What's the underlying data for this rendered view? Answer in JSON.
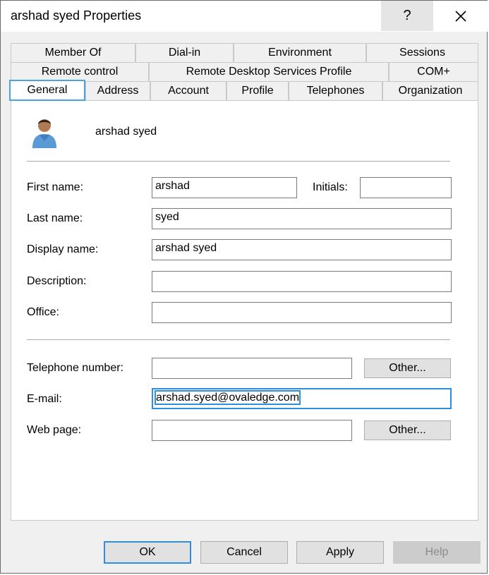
{
  "window": {
    "title": "arshad syed Properties",
    "help_label": "?"
  },
  "tabs": {
    "row1": [
      "Member Of",
      "Dial-in",
      "Environment",
      "Sessions"
    ],
    "row2": [
      "Remote control",
      "Remote Desktop Services Profile",
      "COM+"
    ],
    "row3": [
      "General",
      "Address",
      "Account",
      "Profile",
      "Telephones",
      "Organization"
    ],
    "active": "General"
  },
  "general": {
    "user_icon": "user-avatar-icon",
    "display_header": "arshad syed",
    "first_name_label": "First name:",
    "first_name_value": "arshad",
    "initials_label": "Initials:",
    "initials_value": "",
    "last_name_label": "Last name:",
    "last_name_value": "syed",
    "display_name_label": "Display name:",
    "display_name_value": "arshad syed",
    "description_label": "Description:",
    "description_value": "",
    "office_label": "Office:",
    "office_value": "",
    "telephone_label": "Telephone number:",
    "telephone_value": "",
    "telephone_other_label": "Other...",
    "email_label": "E-mail:",
    "email_value": "arshad.syed@ovaledge.com",
    "webpage_label": "Web page:",
    "webpage_value": "",
    "webpage_other_label": "Other..."
  },
  "footer": {
    "ok_label": "OK",
    "cancel_label": "Cancel",
    "apply_label": "Apply",
    "help_label": "Help"
  },
  "colors": {
    "focus_accent": "#2f8fde",
    "window_bg": "#f0f0f0",
    "panel_bg": "#ffffff"
  }
}
